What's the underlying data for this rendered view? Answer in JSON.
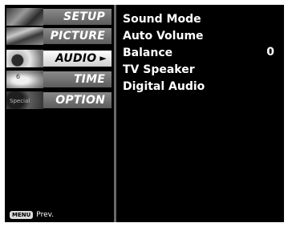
{
  "sidebar": {
    "items": [
      {
        "label": "SETUP",
        "thumb_text": ""
      },
      {
        "label": "PICTURE",
        "thumb_text": ""
      },
      {
        "label": "AUDIO",
        "thumb_text": ""
      },
      {
        "label": "TIME",
        "thumb_text": "6"
      },
      {
        "label": "OPTION",
        "thumb_text": "Special"
      }
    ],
    "active_index": 2,
    "active_arrow": "►"
  },
  "content": {
    "items": [
      {
        "label": "Sound Mode",
        "value": ""
      },
      {
        "label": "Auto Volume",
        "value": ""
      },
      {
        "label": "Balance",
        "value": "0"
      },
      {
        "label": "TV Speaker",
        "value": ""
      },
      {
        "label": "Digital Audio",
        "value": ""
      }
    ]
  },
  "footer": {
    "key_label": "MENU",
    "action_label": "Prev."
  },
  "colors": {
    "background": "#000000",
    "inactive_bar": "#737373",
    "active_bar": "#e8e8e8",
    "text": "#ffffff"
  }
}
